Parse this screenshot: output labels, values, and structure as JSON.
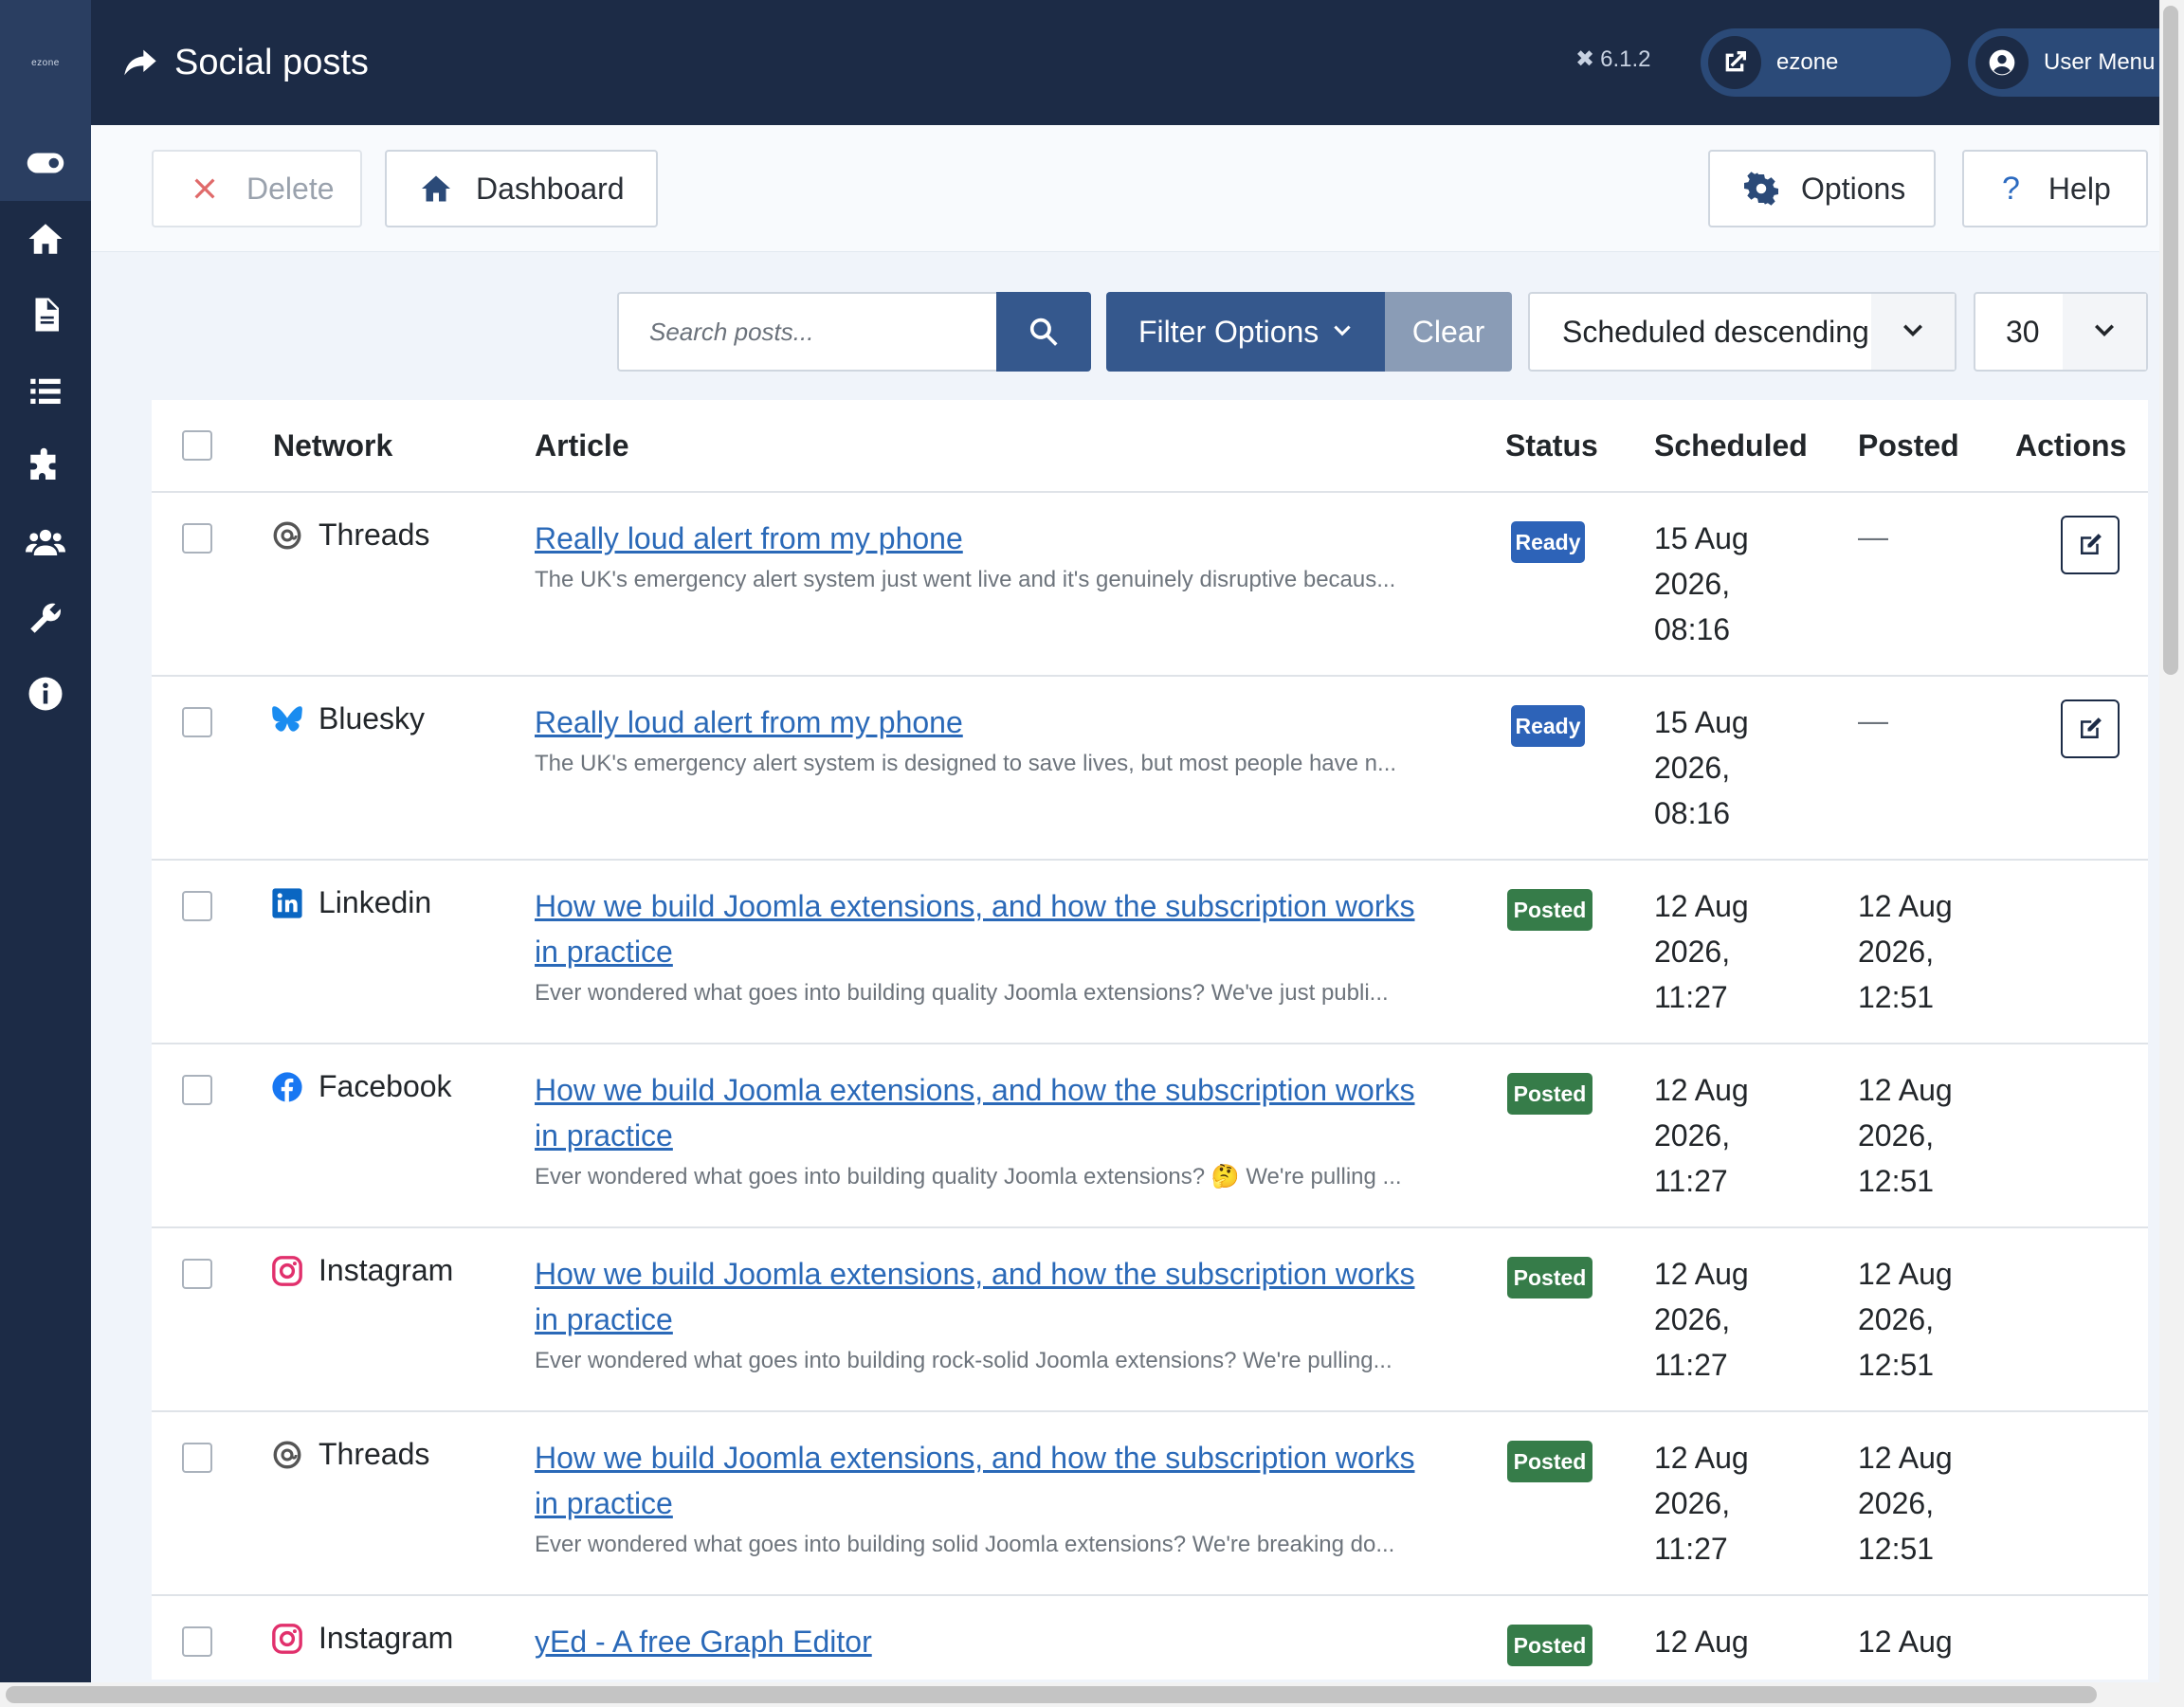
{
  "sidebar": {
    "brand": "ezone"
  },
  "header": {
    "title": "Social posts",
    "version": "6.1.2",
    "site_label": "ezone",
    "user_label": "User Menu"
  },
  "toolbar": {
    "delete_label": "Delete",
    "dashboard_label": "Dashboard",
    "options_label": "Options",
    "help_label": "Help"
  },
  "filters": {
    "search_placeholder": "Search posts...",
    "filter_options_label": "Filter Options",
    "clear_label": "Clear",
    "ordering": "Scheduled descending",
    "limit": "30"
  },
  "table": {
    "columns": [
      "Network",
      "Article",
      "Status",
      "Scheduled",
      "Posted",
      "Actions"
    ],
    "rows": [
      {
        "network": "Threads",
        "title": "Really loud alert from my phone",
        "excerpt": "The UK's emergency alert system just went live and it's genuinely disruptive becaus...",
        "status": "Ready",
        "scheduled": [
          "15 Aug",
          "2026,",
          "08:16"
        ],
        "posted": "—"
      },
      {
        "network": "Bluesky",
        "title": "Really loud alert from my phone",
        "excerpt": "The UK's emergency alert system is designed to save lives, but most people have n...",
        "status": "Ready",
        "scheduled": [
          "15 Aug",
          "2026,",
          "08:16"
        ],
        "posted": "—"
      },
      {
        "network": "Linkedin",
        "title_line1": "How we build Joomla extensions, and how the subscription works",
        "title_line2": "in practice",
        "excerpt": "Ever wondered what goes into building quality Joomla extensions? We've just publi...",
        "status": "Posted",
        "scheduled": [
          "12 Aug",
          "2026,",
          "11:27"
        ],
        "posted": [
          "12 Aug",
          "2026,",
          "12:51"
        ]
      },
      {
        "network": "Facebook",
        "title_line1": "How we build Joomla extensions, and how the subscription works",
        "title_line2": "in practice",
        "excerpt": "Ever wondered what goes into building quality Joomla extensions? 🤔 We're pulling ...",
        "status": "Posted",
        "scheduled": [
          "12 Aug",
          "2026,",
          "11:27"
        ],
        "posted": [
          "12 Aug",
          "2026,",
          "12:51"
        ]
      },
      {
        "network": "Instagram",
        "title_line1": "How we build Joomla extensions, and how the subscription works",
        "title_line2": "in practice",
        "excerpt": "Ever wondered what goes into building rock-solid Joomla extensions? We're pulling...",
        "status": "Posted",
        "scheduled": [
          "12 Aug",
          "2026,",
          "11:27"
        ],
        "posted": [
          "12 Aug",
          "2026,",
          "12:51"
        ]
      },
      {
        "network": "Threads",
        "title_line1": "How we build Joomla extensions, and how the subscription works",
        "title_line2": "in practice",
        "excerpt": "Ever wondered what goes into building solid Joomla extensions? We're breaking do...",
        "status": "Posted",
        "scheduled": [
          "12 Aug",
          "2026,",
          "11:27"
        ],
        "posted": [
          "12 Aug",
          "2026,",
          "12:51"
        ]
      },
      {
        "network": "Instagram",
        "title": "yEd - A free Graph Editor",
        "status": "Posted",
        "scheduled": [
          "12 Aug"
        ],
        "posted": [
          "12 Aug"
        ]
      }
    ]
  },
  "colors": {
    "sidebar_bg": "#1c2b46",
    "accent": "#35588d",
    "link": "#2a69b8",
    "ready": "#2d63b8",
    "posted": "#367c49"
  },
  "icons": {
    "sidebar": [
      "toggle-icon",
      "home-icon",
      "file-icon",
      "list-icon",
      "puzzle-icon",
      "users-icon",
      "wrench-icon",
      "info-icon"
    ]
  }
}
